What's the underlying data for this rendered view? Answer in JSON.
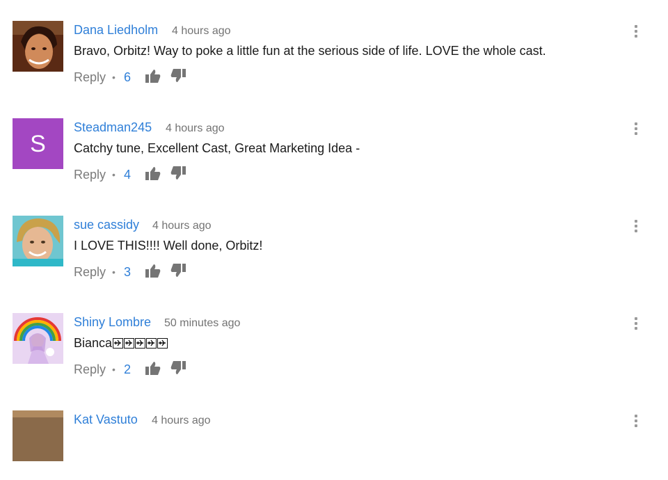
{
  "colors": {
    "link": "#2f7fd8",
    "meta": "#737373",
    "text": "#1a1a1a",
    "avatar_s_bg": "#a347c2"
  },
  "comments": [
    {
      "author": "Dana Liedholm",
      "time": "4 hours ago",
      "text": "Bravo, Orbitz!  Way to poke a little fun at the serious side of life. LOVE the whole cast.",
      "reply_label": "Reply",
      "likes": "6",
      "avatar": "photo-woman-dark-hair"
    },
    {
      "author": "Steadman245",
      "time": "4 hours ago",
      "text": "Catchy tune, Excellent Cast, Great Marketing Idea -",
      "reply_label": "Reply",
      "likes": "4",
      "avatar_letter": "S"
    },
    {
      "author": "sue cassidy",
      "time": "4 hours ago",
      "text": "I LOVE THIS!!!! Well done, Orbitz!",
      "reply_label": "Reply",
      "likes": "3",
      "avatar": "photo-woman-blonde"
    },
    {
      "author": "Shiny Lombre",
      "time": "50 minutes ago",
      "text": "Bianca",
      "text_icons": [
        "airplane-icon",
        "airplane-icon",
        "airplane-icon",
        "airplane-icon",
        "airplane-icon"
      ],
      "reply_label": "Reply",
      "likes": "2",
      "avatar": "anime-rainbow-illustration"
    },
    {
      "author": "Kat Vastuto",
      "time": "4 hours ago"
    }
  ]
}
